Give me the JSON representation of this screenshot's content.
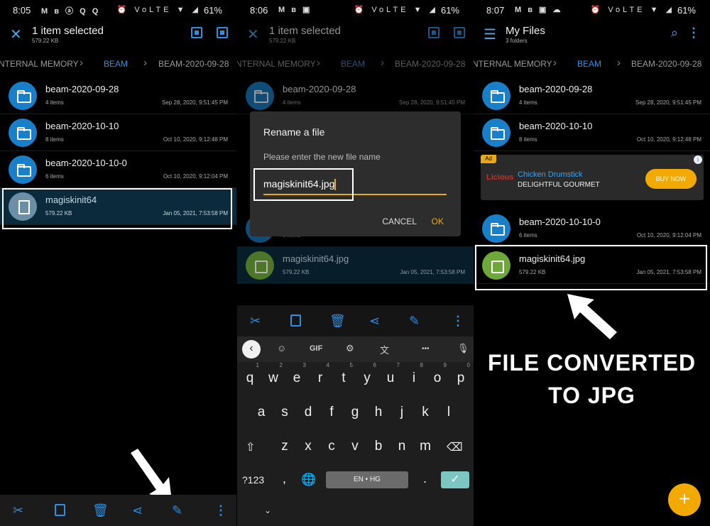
{
  "panels": [
    {
      "status": {
        "time": "8:05",
        "left_icons": "M ʙ ⓐ Q Q",
        "right_icons": "⏰ VoLTE ▼ ◢",
        "battery": "61%"
      },
      "appbar": {
        "title": "1 item selected",
        "subtitle": "579.22 KB"
      },
      "breadcrumb": [
        "NTERNAL MEMORY",
        "BEAM",
        "BEAM-2020-09-28"
      ],
      "rows": [
        {
          "name": "beam-2020-09-28",
          "meta": "4 items",
          "date": "Sep 28, 2020, 9:51:45 PM"
        },
        {
          "name": "beam-2020-10-10",
          "meta": "8 items",
          "date": "Oct 10, 2020, 9:12:48 PM"
        },
        {
          "name": "beam-2020-10-10-0",
          "meta": "6 items",
          "date": "Oct 10, 2020, 9:12:04 PM"
        },
        {
          "name": "magiskinit64",
          "meta": "579.22 KB",
          "date": "Jan 05, 2021, 7:53:58 PM"
        }
      ]
    },
    {
      "status": {
        "time": "8:06",
        "left_icons": "M ʙ ▣",
        "right_icons": "⏰ VoLTE ▼ ◢",
        "battery": "61%"
      },
      "appbar": {
        "title": "1 item selected",
        "subtitle": "579.22 KB"
      },
      "breadcrumb": [
        "NTERNAL MEMORY",
        "BEAM",
        "BEAM-2020-09-28"
      ],
      "rows": [
        {
          "name": "beam-2020-09-28",
          "meta": "4 items",
          "date": "Sep 28, 2020, 9:51:45 PM"
        },
        {
          "name": "",
          "meta": "6 items",
          "date": ""
        },
        {
          "name": "magiskinit64.jpg",
          "meta": "579.22 KB",
          "date": "Jan 05, 2021, 7:53:58 PM"
        }
      ],
      "dialog": {
        "title": "Rename a file",
        "message": "Please enter the new file name",
        "value": "magiskinit64.jpg",
        "cancel": "CANCEL",
        "ok": "OK"
      },
      "keyboard": {
        "strip": {
          "gif": "GIF",
          "more": "•••"
        },
        "row1": [
          "q",
          "w",
          "e",
          "r",
          "t",
          "y",
          "u",
          "i",
          "o",
          "p"
        ],
        "row1_hints": [
          "1",
          "2",
          "3",
          "4",
          "5",
          "6",
          "7",
          "8",
          "9",
          "0"
        ],
        "row2": [
          "a",
          "s",
          "d",
          "f",
          "g",
          "h",
          "j",
          "k",
          "l"
        ],
        "row3": [
          "z",
          "x",
          "c",
          "v",
          "b",
          "n",
          "m"
        ],
        "sym": "?123",
        "comma": ",",
        "space": "EN • HG",
        "period": "."
      }
    },
    {
      "status": {
        "time": "8:07",
        "left_icons": "M ʙ ▣ ☁",
        "right_icons": "⏰ VoLTE ▼ ◢",
        "battery": "61%"
      },
      "appbar": {
        "title": "My Files",
        "subtitle": "3 folders"
      },
      "breadcrumb": [
        "NTERNAL MEMORY",
        "BEAM",
        "BEAM-2020-09-28"
      ],
      "rows_top": [
        {
          "name": "beam-2020-09-28",
          "meta": "4 items",
          "date": "Sep 28, 2020, 9:51:45 PM"
        },
        {
          "name": "beam-2020-10-10",
          "meta": "8 items",
          "date": "Oct 10, 2020, 9:12:48 PM"
        }
      ],
      "ad": {
        "tag": "Ad",
        "logo": "Licious",
        "headline": "Chicken Drumstick",
        "body": "DELIGHTFUL GOURMET",
        "cta": "BUY NOW"
      },
      "rows_bottom": [
        {
          "name": "beam-2020-10-10-0",
          "meta": "6 items",
          "date": "Oct 10, 2020, 9:12:04 PM"
        },
        {
          "name": "magiskinit64.jpg",
          "meta": "579.22 KB",
          "date": "Jan 05, 2021, 7:53:58 PM"
        }
      ],
      "caption": [
        "FILE CONVERTED",
        "TO JPG"
      ]
    }
  ],
  "colors": {
    "accent": "#2f8ee0",
    "dialog_accent": "#e6a81f",
    "folder": "#1a7fc9",
    "image_file": "#6ea83a"
  }
}
